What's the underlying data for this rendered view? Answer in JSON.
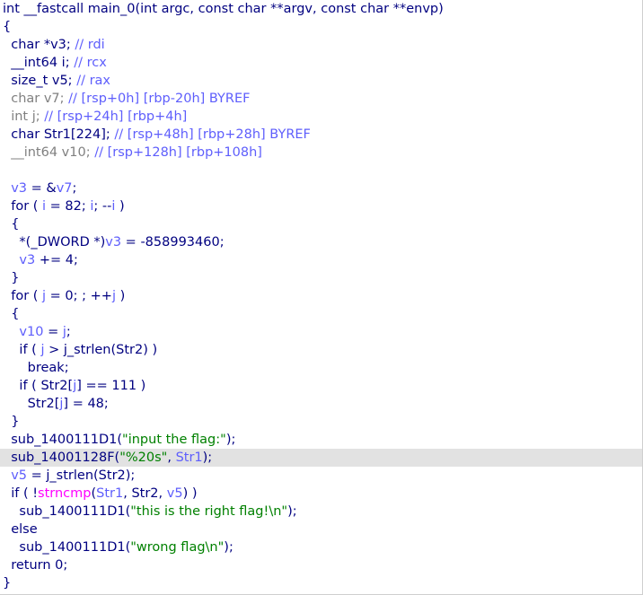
{
  "lines": [
    [
      [
        "kw",
        "int __fastcall main_0(int argc, const char **argv, const char **envp)"
      ]
    ],
    [
      [
        "sym",
        "{"
      ]
    ],
    [
      [
        "kw",
        "  char *v3; "
      ],
      [
        "lcmt",
        "// rdi"
      ]
    ],
    [
      [
        "kw",
        "  __int64 i; "
      ],
      [
        "lcmt",
        "// rcx"
      ]
    ],
    [
      [
        "kw",
        "  size_t v5; "
      ],
      [
        "lcmt",
        "// rax"
      ]
    ],
    [
      [
        "lvar",
        "  char v7; "
      ],
      [
        "lcmt",
        "// [rsp+0h] [rbp-20h] BYREF"
      ]
    ],
    [
      [
        "lvar",
        "  int j; "
      ],
      [
        "lcmt",
        "// [rsp+24h] [rbp+4h]"
      ]
    ],
    [
      [
        "kw",
        "  char Str1[224]; "
      ],
      [
        "lcmt",
        "// [rsp+48h] [rbp+28h] BYREF"
      ]
    ],
    [
      [
        "lvar",
        "  __int64 v10; "
      ],
      [
        "lcmt",
        "// [rsp+128h] [rbp+108h]"
      ]
    ],
    [
      [
        "kw",
        ""
      ]
    ],
    [
      [
        "lcmt",
        "  v3"
      ],
      [
        "kw",
        " = &"
      ],
      [
        "lcmt",
        "v7"
      ],
      [
        "kw",
        ";"
      ]
    ],
    [
      [
        "kw",
        "  for ( "
      ],
      [
        "lcmt",
        "i"
      ],
      [
        "kw",
        " = 82; "
      ],
      [
        "lcmt",
        "i"
      ],
      [
        "kw",
        "; --"
      ],
      [
        "lcmt",
        "i"
      ],
      [
        "kw",
        " )"
      ]
    ],
    [
      [
        "sym",
        "  {"
      ]
    ],
    [
      [
        "kw",
        "    *(_DWORD *)"
      ],
      [
        "lcmt",
        "v3"
      ],
      [
        "kw",
        " = -858993460;"
      ]
    ],
    [
      [
        "lcmt",
        "    v3"
      ],
      [
        "kw",
        " += 4;"
      ]
    ],
    [
      [
        "sym",
        "  }"
      ]
    ],
    [
      [
        "kw",
        "  for ( "
      ],
      [
        "lcmt",
        "j"
      ],
      [
        "kw",
        " = 0; ; ++"
      ],
      [
        "lcmt",
        "j"
      ],
      [
        "kw",
        " )"
      ]
    ],
    [
      [
        "sym",
        "  {"
      ]
    ],
    [
      [
        "lcmt",
        "    v10"
      ],
      [
        "kw",
        " = "
      ],
      [
        "lcmt",
        "j"
      ],
      [
        "kw",
        ";"
      ]
    ],
    [
      [
        "kw",
        "    if ( "
      ],
      [
        "lcmt",
        "j"
      ],
      [
        "kw",
        " > j_strlen(Str2) )"
      ]
    ],
    [
      [
        "kw",
        "      break;"
      ]
    ],
    [
      [
        "kw",
        "    if ( Str2["
      ],
      [
        "lcmt",
        "j"
      ],
      [
        "kw",
        "] == 111 )"
      ]
    ],
    [
      [
        "kw",
        "      Str2["
      ],
      [
        "lcmt",
        "j"
      ],
      [
        "kw",
        "] = 48;"
      ]
    ],
    [
      [
        "sym",
        "  }"
      ]
    ],
    [
      [
        "kw",
        "  sub_1400111D1("
      ],
      [
        "str",
        "\"input the flag:\""
      ],
      [
        "kw",
        ");"
      ]
    ],
    [
      [
        "kw",
        "  sub_14001128F("
      ],
      [
        "str",
        "\"%20s\""
      ],
      [
        "kw",
        ", "
      ],
      [
        "lcmt",
        "Str1"
      ],
      [
        "kw",
        ");"
      ]
    ],
    [
      [
        "lcmt",
        "  v5"
      ],
      [
        "kw",
        " = j_strlen(Str2);"
      ]
    ],
    [
      [
        "kw",
        "  if ( !"
      ],
      [
        "lib",
        "strncmp"
      ],
      [
        "kw",
        "("
      ],
      [
        "lcmt",
        "Str1"
      ],
      [
        "kw",
        ", Str2, "
      ],
      [
        "lcmt",
        "v5"
      ],
      [
        "kw",
        ") )"
      ]
    ],
    [
      [
        "kw",
        "    sub_1400111D1("
      ],
      [
        "str",
        "\"this is the right flag!\\n\""
      ],
      [
        "kw",
        ");"
      ]
    ],
    [
      [
        "kw",
        "  else"
      ]
    ],
    [
      [
        "kw",
        "    sub_1400111D1("
      ],
      [
        "str",
        "\"wrong flag\\n\""
      ],
      [
        "kw",
        ");"
      ]
    ],
    [
      [
        "kw",
        "  return 0;"
      ]
    ],
    [
      [
        "sym",
        "}"
      ]
    ]
  ],
  "selected_line": 25,
  "colors": {
    "keyword": "#000080",
    "string": "#008000",
    "comment": "#5e5efc",
    "local_var": "#808080",
    "library_call": "#ff00ff",
    "selection": "#e2e2e2",
    "background": "#ffffff"
  }
}
